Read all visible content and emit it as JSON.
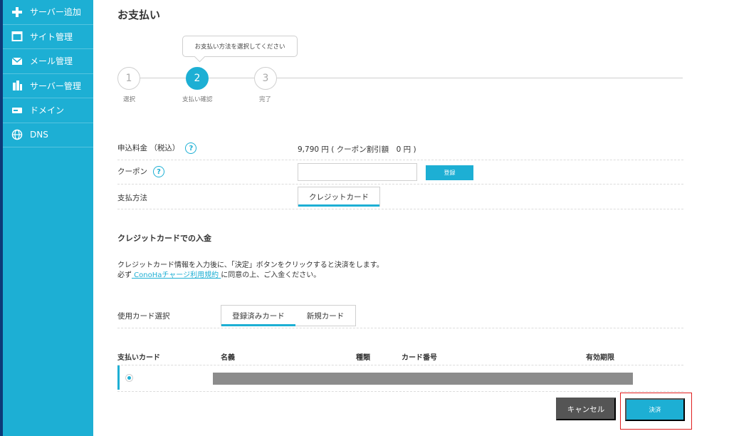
{
  "sidebar": {
    "items": [
      {
        "label": "サーバー追加",
        "icon": "plus-icon"
      },
      {
        "label": "サイト管理",
        "icon": "window-icon"
      },
      {
        "label": "メール管理",
        "icon": "mail-icon"
      },
      {
        "label": "サーバー管理",
        "icon": "server-icon"
      },
      {
        "label": "ドメイン",
        "icon": "domain-icon"
      },
      {
        "label": "DNS",
        "icon": "globe-icon"
      }
    ]
  },
  "page": {
    "title": "お支払い"
  },
  "stepper": {
    "tooltip": "お支払い方法を選択してください",
    "steps": [
      {
        "number": "1",
        "label": "選択"
      },
      {
        "number": "2",
        "label": "支払い確認"
      },
      {
        "number": "3",
        "label": "完了"
      }
    ],
    "current_step": 2
  },
  "fee": {
    "label": "申込料金 （税込）",
    "value": "9,790 円 ( クーポン割引額　0 円 )"
  },
  "coupon": {
    "label": "クーポン",
    "input_value": "",
    "button_label": "登録"
  },
  "payment_method": {
    "label": "支払方法",
    "tab_label": "クレジットカード"
  },
  "credit_section": {
    "title": "クレジットカードでの入金",
    "line1": "クレジットカード情報を入力後に、「決定」ボタンをクリックすると決済をします。",
    "line2_prefix": "必ず",
    "line2_link": " ConoHaチャージ利用規約 ",
    "line2_suffix": "に同意の上、ご入金ください。"
  },
  "card_select": {
    "label": "使用カード選択",
    "tabs": [
      "登録済みカード",
      "新規カード"
    ],
    "active_tab": 0
  },
  "card_table": {
    "headers": [
      "支払いカード",
      "名義",
      "種類",
      "カード番号",
      "有効期限"
    ]
  },
  "actions": {
    "cancel_label": "キャンセル",
    "pay_label": "決済"
  },
  "colors": {
    "accent": "#1dafd4",
    "cancel": "#555555",
    "highlight": "#e02020"
  }
}
